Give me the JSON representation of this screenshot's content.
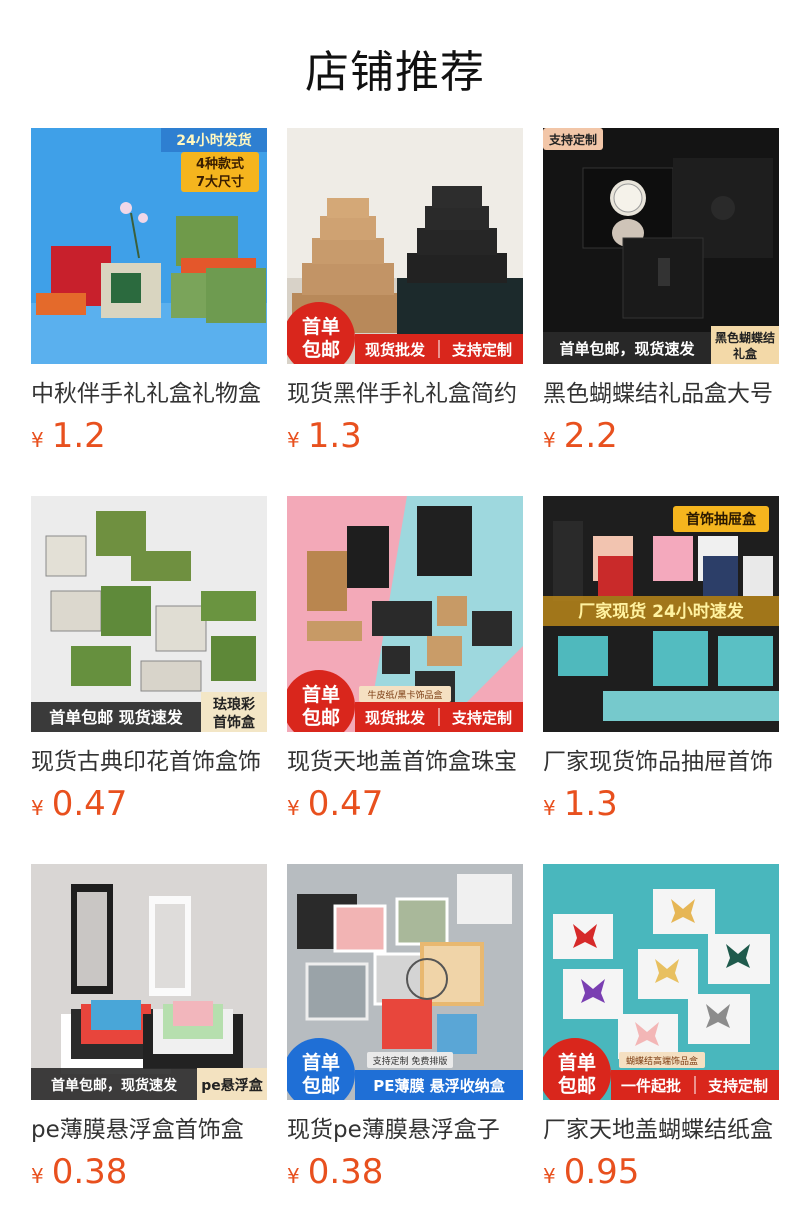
{
  "page_title": "店铺推荐",
  "currency_symbol": "¥",
  "products": [
    {
      "name": "中秋伴手礼礼盒礼物盒",
      "price": "1.2",
      "image_texts": [
        "24小时发货",
        "4种款式",
        "7大尺寸"
      ]
    },
    {
      "name": "现货黑伴手礼礼盒简约",
      "price": "1.3",
      "image_texts": [
        "首单",
        "包邮",
        "现货批发",
        "支持定制"
      ]
    },
    {
      "name": "黑色蝴蝶结礼品盒大号",
      "price": "2.2",
      "image_texts": [
        "支持定制",
        "首单包邮，现货速发",
        "黑色蝴蝶结",
        "礼盒"
      ]
    },
    {
      "name": "现货古典印花首饰盒饰",
      "price": "0.47",
      "image_texts": [
        "首单包邮 现货速发",
        "珐琅彩",
        "首饰盒"
      ]
    },
    {
      "name": "现货天地盖首饰盒珠宝",
      "price": "0.47",
      "image_texts": [
        "首单",
        "包邮",
        "牛皮纸/黑卡饰品盒",
        "现货批发",
        "支持定制"
      ]
    },
    {
      "name": "厂家现货饰品抽屉首饰",
      "price": "1.3",
      "image_texts": [
        "首饰抽屉盒",
        "厂家现货 24小时速发"
      ]
    },
    {
      "name": "pe薄膜悬浮盒首饰盒",
      "price": "0.38",
      "image_texts": [
        "首单包邮，现货速发",
        "pe悬浮盒"
      ]
    },
    {
      "name": "现货pe薄膜悬浮盒子",
      "price": "0.38",
      "image_texts": [
        "首单",
        "包邮",
        "支持定制 免费排版",
        "PE薄膜 悬浮收纳盒"
      ]
    },
    {
      "name": "厂家天地盖蝴蝶结纸盒",
      "price": "0.95",
      "image_texts": [
        "首单",
        "包邮",
        "蝴蝶结高端饰品盒",
        "一件起批",
        "支持定制"
      ]
    }
  ],
  "colors": {
    "price": "#e8501e",
    "badge_red": "#d9261c",
    "banner_gold": "#f5b51e"
  }
}
